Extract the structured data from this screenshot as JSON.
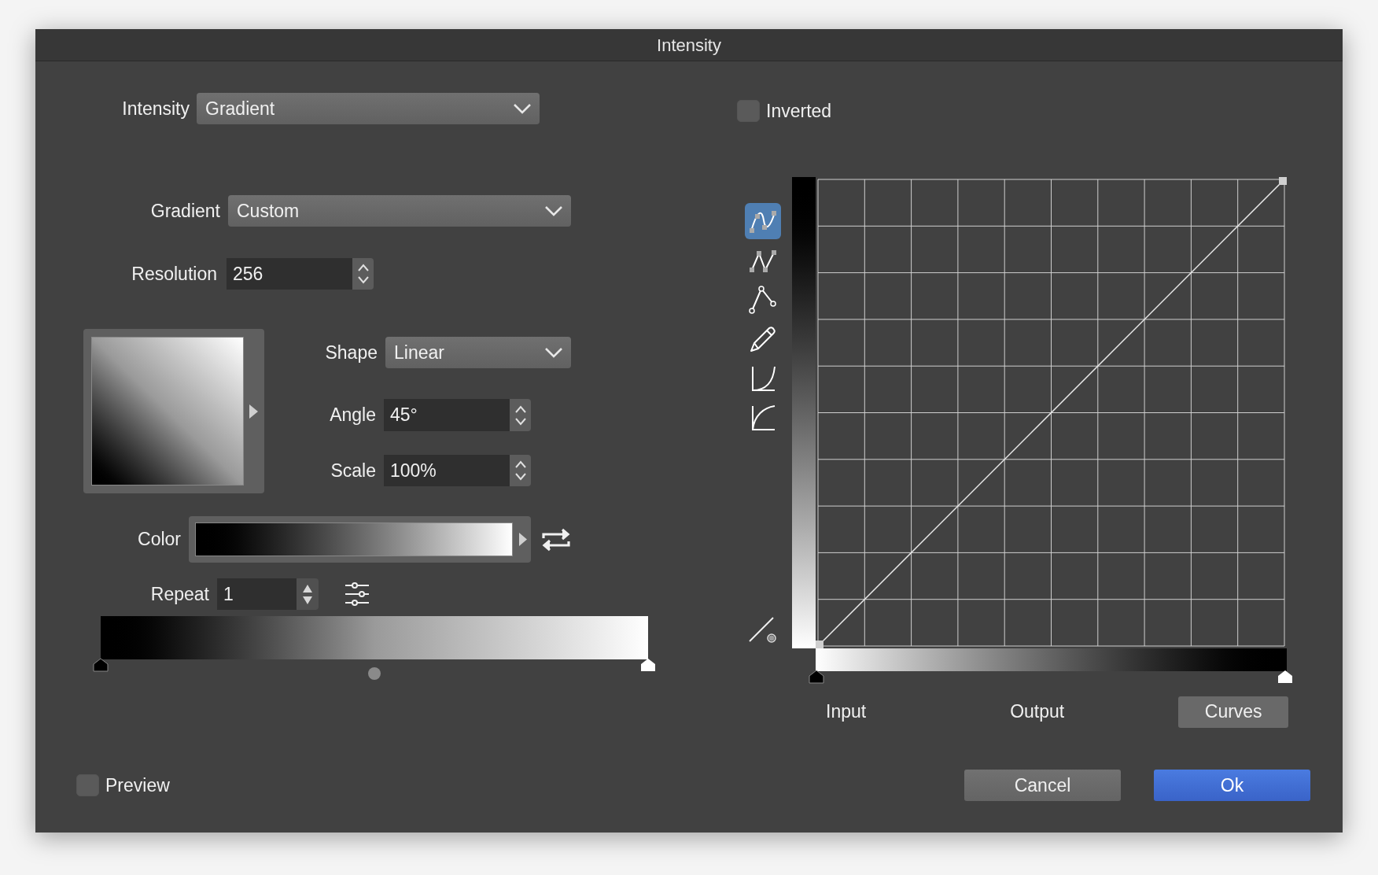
{
  "window": {
    "title": "Intensity"
  },
  "intensity": {
    "label": "Intensity",
    "value": "Gradient"
  },
  "inverted": {
    "label": "Inverted",
    "checked": false
  },
  "gradient": {
    "label": "Gradient",
    "value": "Custom"
  },
  "resolution": {
    "label": "Resolution",
    "value": "256"
  },
  "shape": {
    "label": "Shape",
    "value": "Linear"
  },
  "angle": {
    "label": "Angle",
    "value": "45°"
  },
  "scale": {
    "label": "Scale",
    "value": "100%"
  },
  "color": {
    "label": "Color"
  },
  "repeat": {
    "label": "Repeat",
    "value": "1"
  },
  "curve_tools": [
    {
      "selected": true
    },
    {
      "selected": false
    },
    {
      "selected": false
    },
    {
      "selected": false
    },
    {
      "selected": false
    },
    {
      "selected": false
    }
  ],
  "curve_tabs": [
    {
      "label": "Input",
      "selected": false
    },
    {
      "label": "Output",
      "selected": false
    },
    {
      "label": "Curves",
      "selected": true
    }
  ],
  "preview": {
    "label": "Preview",
    "checked": false
  },
  "buttons": [
    {
      "label": "Cancel",
      "kind": "secondary"
    },
    {
      "label": "Ok",
      "kind": "primary"
    }
  ]
}
